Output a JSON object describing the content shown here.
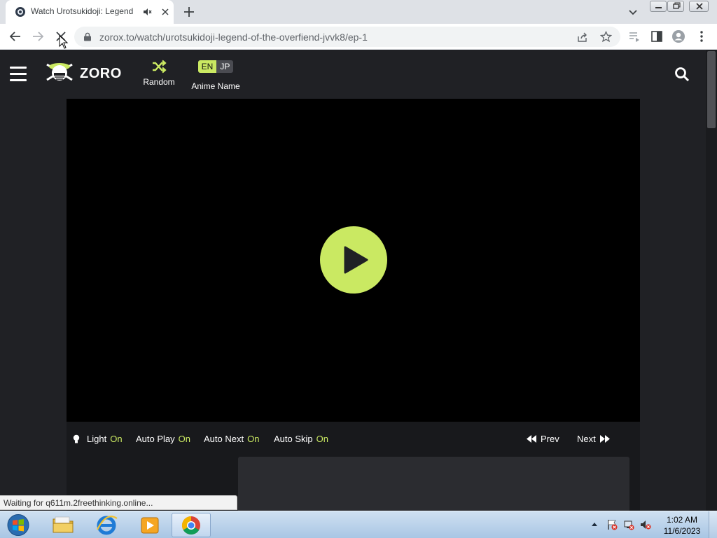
{
  "browser": {
    "tab": {
      "title": "Watch Urotsukidoji: Legend",
      "favicon": "site-favicon-icon",
      "audio_icon": "speaker-muted-icon"
    },
    "url": "zorox.to/watch/urotsukidoji-legend-of-the-overfiend-jvvk8/ep-1",
    "loading": true,
    "status_text": "Waiting for q611m.2freethinking.online..."
  },
  "site": {
    "logo_text": "ZORO",
    "nav": {
      "random_label": "Random",
      "lang_en": "EN",
      "lang_jp": "JP",
      "lang_label": "Anime Name",
      "active_lang": "EN"
    }
  },
  "player": {
    "controls": {
      "light": {
        "label": "Light",
        "state": "On"
      },
      "autoplay": {
        "label": "Auto Play",
        "state": "On"
      },
      "autonext": {
        "label": "Auto Next",
        "state": "On"
      },
      "autoskip": {
        "label": "Auto Skip",
        "state": "On"
      },
      "prev_label": "Prev",
      "next_label": "Next"
    }
  },
  "taskbar": {
    "apps": [
      "file-explorer",
      "internet-explorer",
      "media-player",
      "chrome"
    ],
    "active_app": "chrome",
    "clock": {
      "time": "1:02 AM",
      "date": "11/6/2023"
    }
  },
  "colors": {
    "accent": "#cae962",
    "page_bg": "#202125",
    "player_bg": "#000000"
  }
}
